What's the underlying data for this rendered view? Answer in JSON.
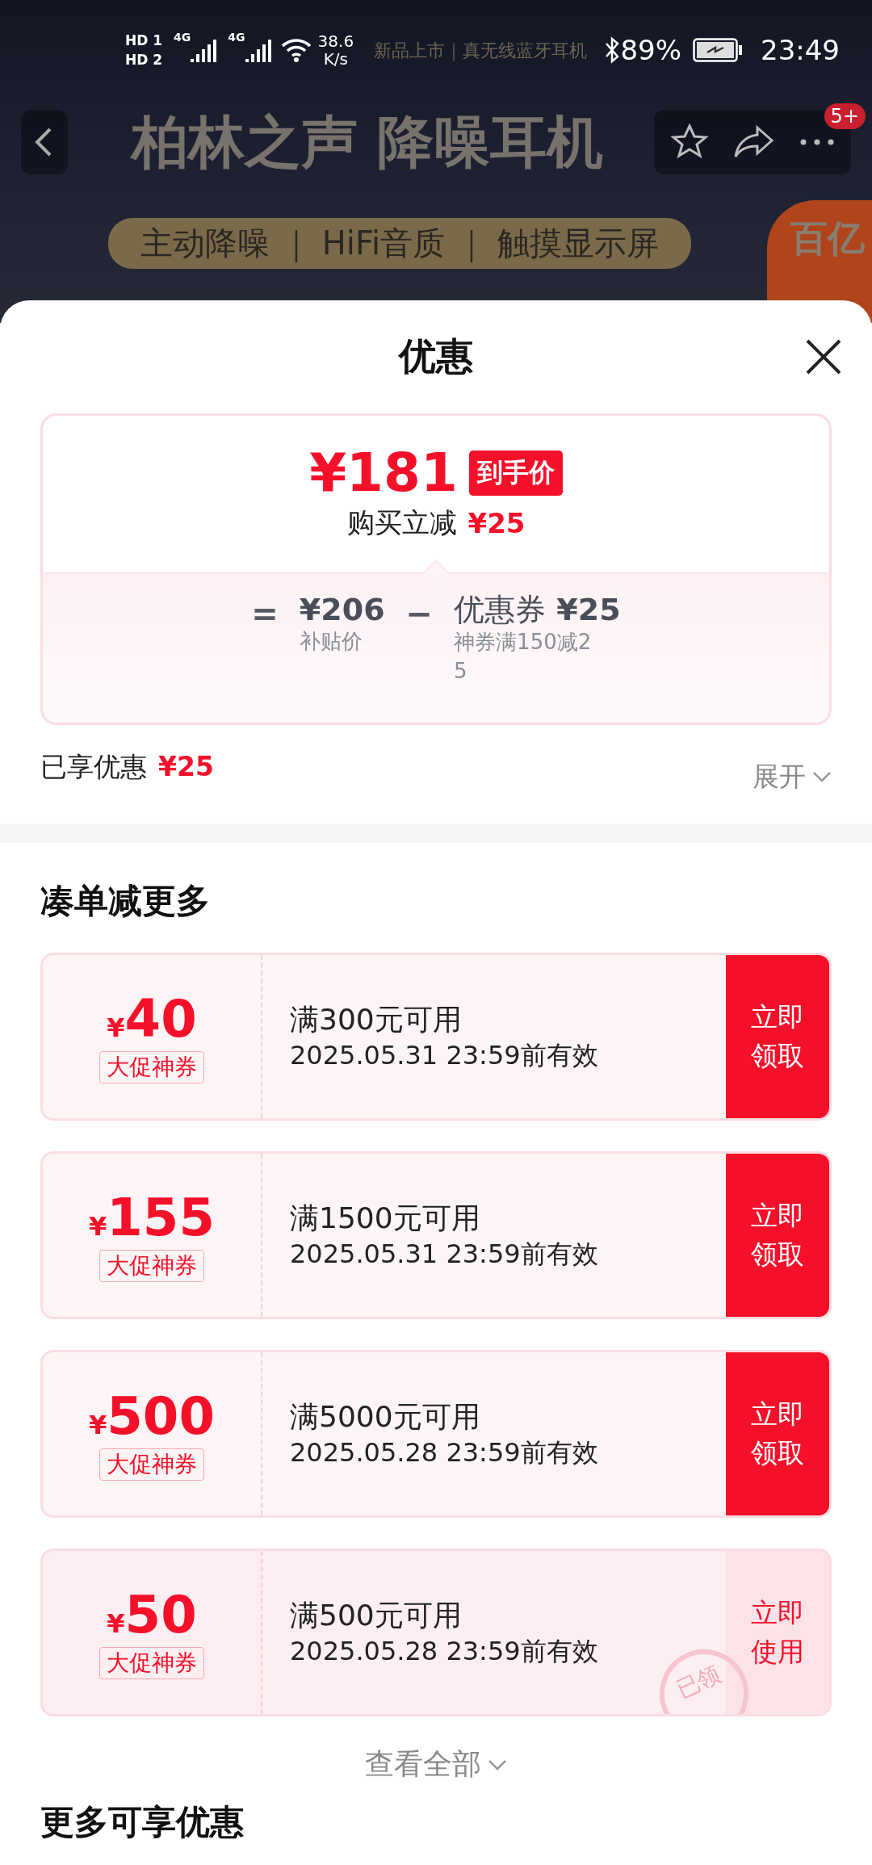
{
  "status_bar": {
    "sim_1": "HD",
    "sim_1_index": "1",
    "sim_2": "HD",
    "sim_2_index": "2",
    "network_1": "4G",
    "network_2": "4G",
    "speed_value": "38.6",
    "speed_unit": "K/s",
    "battery": "89%",
    "time": "23:49"
  },
  "banner": {
    "tagline": "新品上市｜真无线蓝牙耳机",
    "headline": "柏林之声 降噪耳机",
    "features": "主动降噪 ｜ HiFi音质 ｜ 触摸显示屏",
    "badge_line_1": "百亿"
  },
  "nav": {
    "notification_count": "5+"
  },
  "sheet": {
    "title": "优惠"
  },
  "price_card": {
    "price": "¥181",
    "price_tag": "到手价",
    "saving_label": "购买立减",
    "saving_amount": "¥25",
    "equals": "=",
    "base_price": "¥206",
    "base_label": "补贴价",
    "minus": "−",
    "coupon_label": "优惠券",
    "coupon_amount": "¥25",
    "coupon_note": "神券满150减25"
  },
  "enjoyed": {
    "label": "已享优惠",
    "amount": "¥25",
    "expand": "展开"
  },
  "combo_section": {
    "title": "凑单减更多"
  },
  "coupons": [
    {
      "currency": "¥",
      "amount": "40",
      "tag": "大促神券",
      "condition": "满300元可用",
      "validity": "2025.05.31 23:59前有效",
      "action": "立即领取",
      "kind": "claim"
    },
    {
      "currency": "¥",
      "amount": "155",
      "tag": "大促神券",
      "condition": "满1500元可用",
      "validity": "2025.05.31 23:59前有效",
      "action": "立即领取",
      "kind": "claim"
    },
    {
      "currency": "¥",
      "amount": "500",
      "tag": "大促神券",
      "condition": "满5000元可用",
      "validity": "2025.05.28 23:59前有效",
      "action": "立即领取",
      "kind": "claim"
    },
    {
      "currency": "¥",
      "amount": "50",
      "tag": "大促神券",
      "condition": "满500元可用",
      "validity": "2025.05.28 23:59前有效",
      "action": "立即使用",
      "kind": "claimed",
      "stamp": "已领"
    }
  ],
  "view_all": "查看全部",
  "more_section": {
    "title": "更多可享优惠"
  }
}
